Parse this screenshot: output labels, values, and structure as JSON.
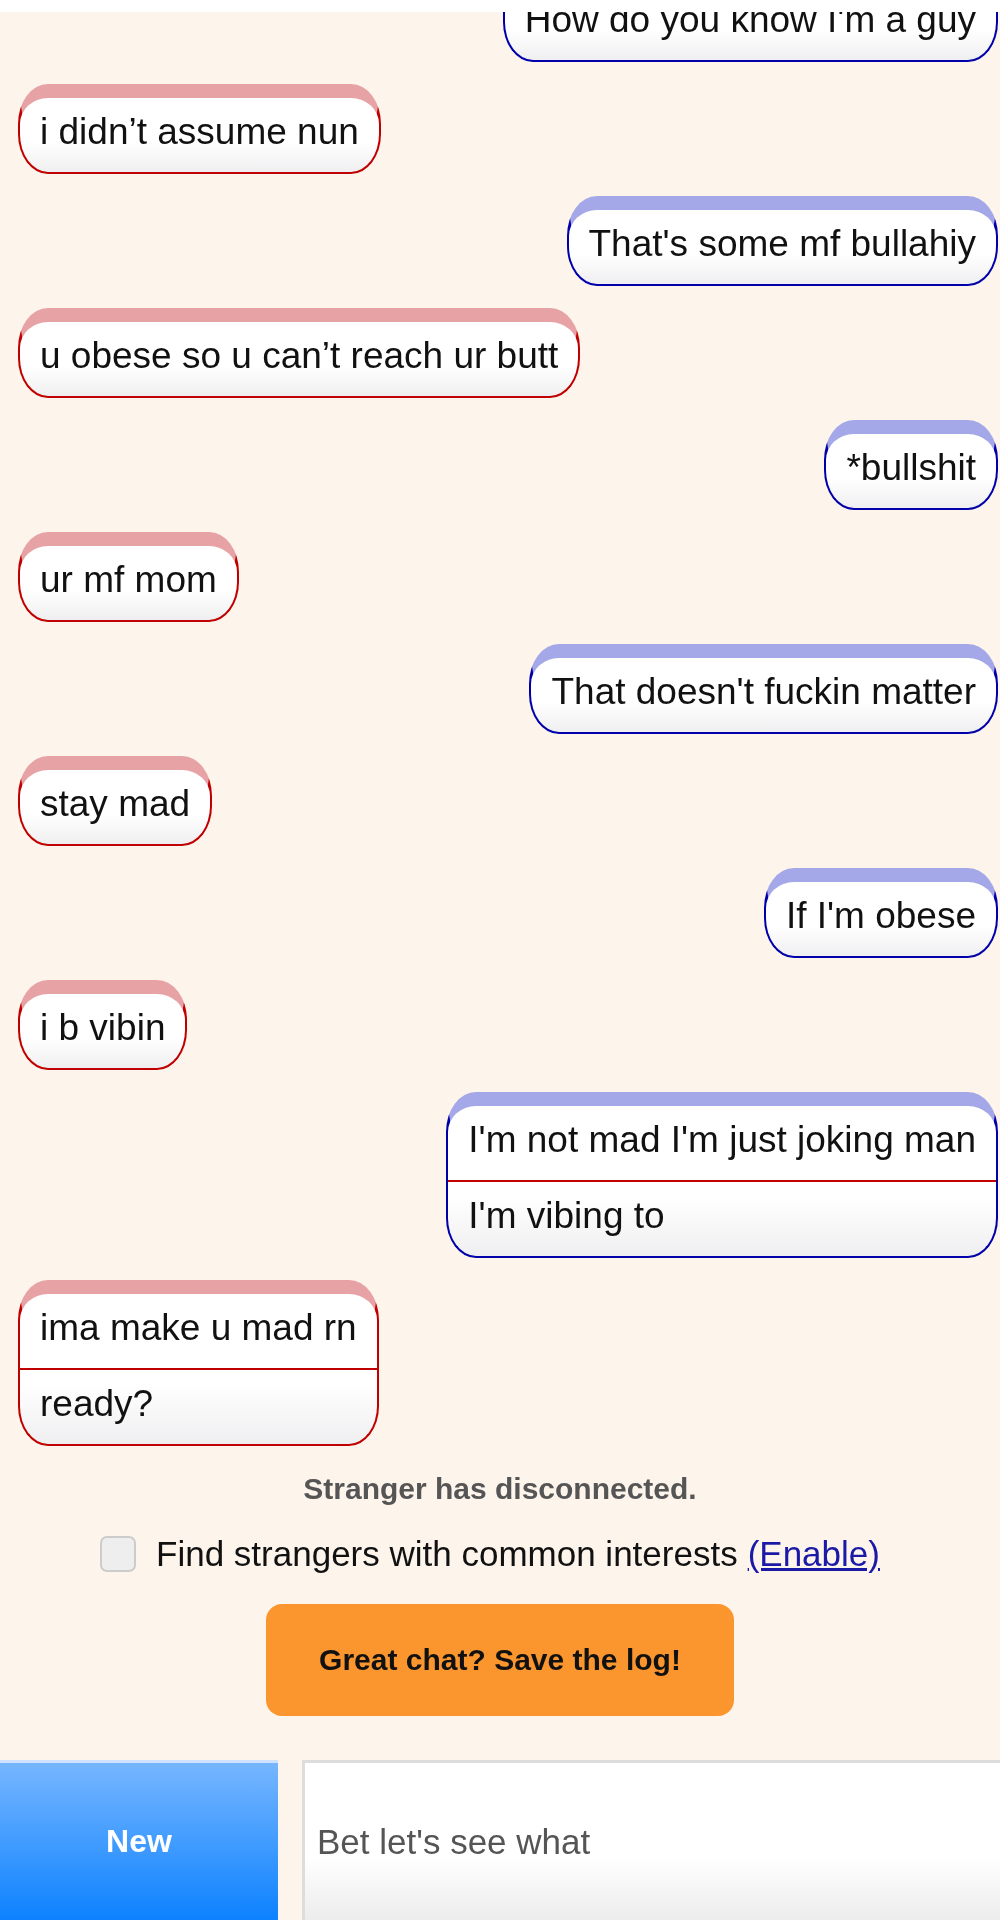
{
  "messages": [
    {
      "kind": "you",
      "lines": [
        "How do you know I'm a guy"
      ]
    },
    {
      "kind": "stranger",
      "lines": [
        "i didn’t assume nun"
      ]
    },
    {
      "kind": "you",
      "lines": [
        "That's some mf bullahiy"
      ]
    },
    {
      "kind": "stranger",
      "lines": [
        "u obese so u can’t reach ur butt"
      ]
    },
    {
      "kind": "you",
      "lines": [
        "*bullshit"
      ]
    },
    {
      "kind": "stranger",
      "lines": [
        "ur mf mom"
      ]
    },
    {
      "kind": "you",
      "lines": [
        "That doesn't fuckin matter"
      ]
    },
    {
      "kind": "stranger",
      "lines": [
        "stay mad"
      ]
    },
    {
      "kind": "you",
      "lines": [
        "If I'm obese"
      ]
    },
    {
      "kind": "stranger",
      "lines": [
        "i b vibin"
      ]
    },
    {
      "kind": "you",
      "lines": [
        "I'm not mad I'm just joking man",
        "I'm vibing to"
      ]
    },
    {
      "kind": "stranger",
      "lines": [
        "ima make u mad rn",
        "ready?"
      ]
    }
  ],
  "status": "Stranger has disconnected.",
  "interests": {
    "checked": false,
    "label": "Find strangers with common interests",
    "link": "(Enable)"
  },
  "save_button": "Great chat? Save the log!",
  "new_button": "New",
  "message_input": {
    "value": "Bet let's see what"
  }
}
